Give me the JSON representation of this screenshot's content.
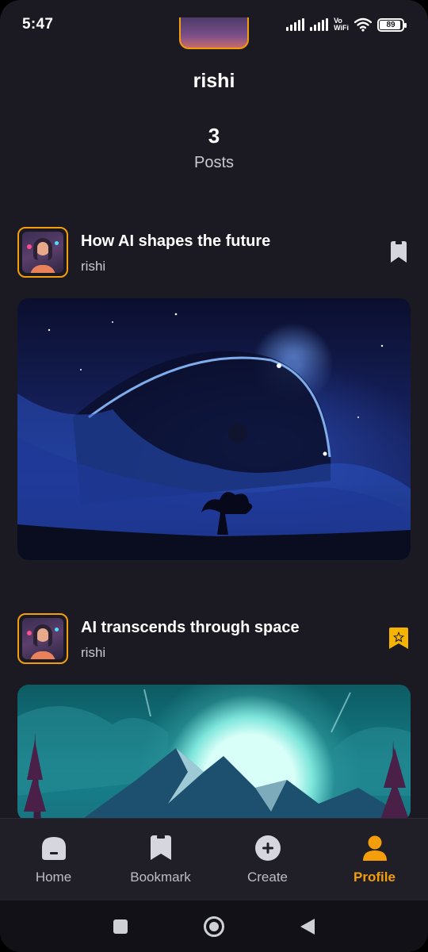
{
  "status_bar": {
    "time": "5:47",
    "vowifi_line1": "Vo",
    "vowifi_line2": "WiFi",
    "battery": "89"
  },
  "profile": {
    "name": "rishi",
    "post_count": "3",
    "post_label": "Posts"
  },
  "posts": [
    {
      "title": "How AI shapes the future",
      "author": "rishi",
      "bookmarked": false,
      "image": "space-planet-landscape"
    },
    {
      "title": "AI transcends through space",
      "author": "rishi",
      "bookmarked": true,
      "image": "moon-mountains-landscape"
    }
  ],
  "nav": {
    "items": [
      {
        "label": "Home",
        "icon": "home-icon"
      },
      {
        "label": "Bookmark",
        "icon": "bookmark-icon"
      },
      {
        "label": "Create",
        "icon": "plus-circle-icon"
      },
      {
        "label": "Profile",
        "icon": "user-icon",
        "active": true
      }
    ]
  },
  "colors": {
    "background": "#1b1a22",
    "accent": "#f59e0b",
    "nav_background": "#201f28",
    "text_muted": "#c9c9d1"
  }
}
